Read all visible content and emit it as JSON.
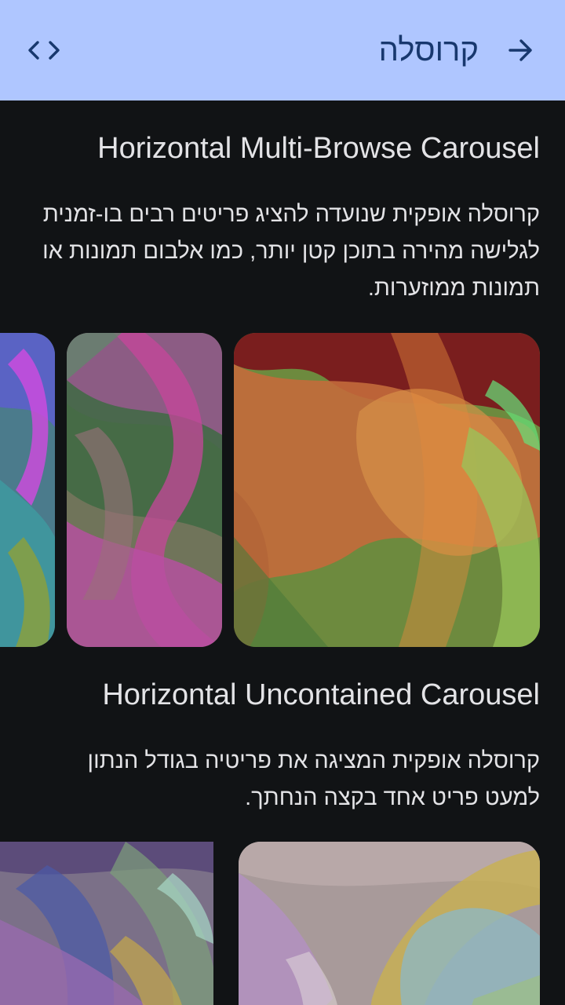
{
  "topbar": {
    "title": "קרוסלה",
    "back_icon": "arrow-right-icon",
    "code_icon": "code-icon",
    "background": "#afc6ff",
    "foreground": "#18386e"
  },
  "sections": [
    {
      "title": "Horizontal Multi-Browse Carousel",
      "description": "קרוסלה אופקית שנועדה להציג פריטים רבים בו-זמנית לגלישה מהירה בתוכן קטן יותר, כמו אלבום תמונות או תמונות ממוזערות."
    },
    {
      "title": "Horizontal Uncontained Carousel",
      "description": "קרוסלה אופקית המציגה את פריטיה בגודל הנתון למעט פריט אחד בקצה הנחתך."
    }
  ],
  "colors": {
    "background": "#111315",
    "text": "#e3e3e6"
  }
}
